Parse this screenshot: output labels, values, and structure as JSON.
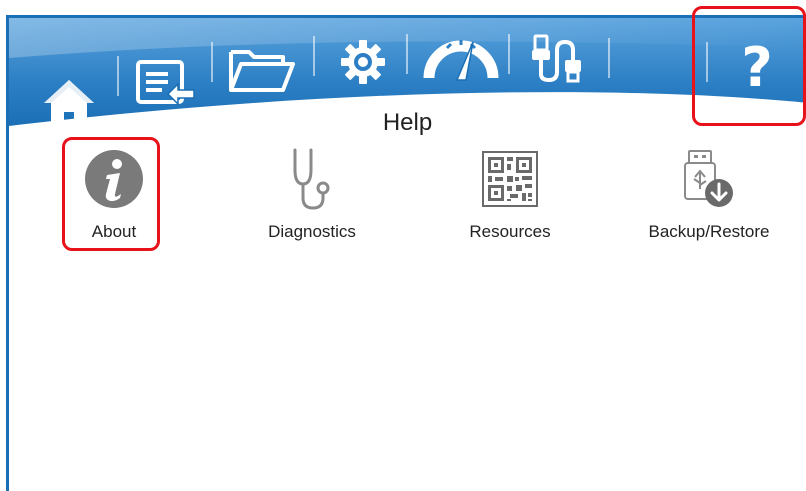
{
  "colors": {
    "header_blue": "#1b6fb5",
    "header_light": "#4e9ad6",
    "highlight_red": "#e8121b",
    "icon_gray": "#7a7a7a"
  },
  "toolbar": {
    "items": [
      {
        "icon": "home-icon"
      },
      {
        "icon": "display-back-icon"
      },
      {
        "icon": "folder-icon"
      },
      {
        "icon": "gear-icon"
      },
      {
        "icon": "gauge-icon"
      },
      {
        "icon": "usb-cable-icon"
      },
      {
        "icon": "help-icon",
        "glyph": "?"
      }
    ]
  },
  "page": {
    "title": "Help"
  },
  "menu": {
    "items": [
      {
        "label": "About",
        "icon": "info-icon"
      },
      {
        "label": "Diagnostics",
        "icon": "stethoscope-icon"
      },
      {
        "label": "Resources",
        "icon": "qr-code-icon"
      },
      {
        "label": "Backup/Restore",
        "icon": "usb-download-icon"
      }
    ]
  }
}
